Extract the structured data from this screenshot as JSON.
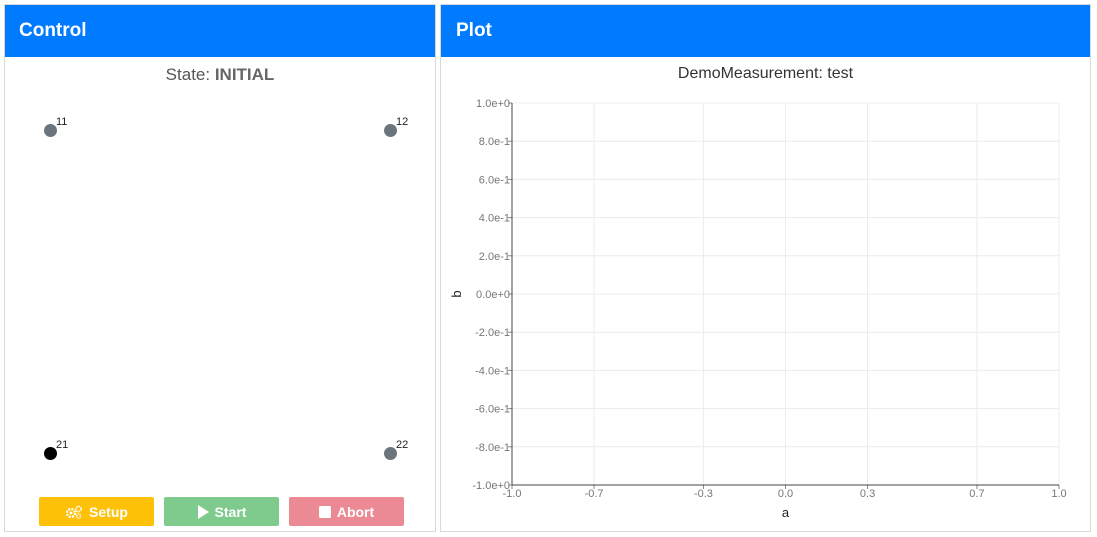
{
  "control": {
    "title": "Control",
    "state_prefix": "State: ",
    "state_value": "INITIAL",
    "nodes": [
      {
        "label": "11",
        "active": false
      },
      {
        "label": "12",
        "active": false
      },
      {
        "label": "21",
        "active": true
      },
      {
        "label": "22",
        "active": false
      }
    ],
    "buttons": {
      "setup": {
        "label": "Setup",
        "icon": "gears-icon",
        "color": "#ffc107"
      },
      "start": {
        "label": "Start",
        "icon": "play-icon",
        "color": "#7fcb8d"
      },
      "abort": {
        "label": "Abort",
        "icon": "stop-icon",
        "color": "#eb8a94"
      }
    }
  },
  "plot": {
    "title": "Plot",
    "chart_data": {
      "type": "line",
      "title": "DemoMeasurement: test",
      "xlabel": "a",
      "ylabel": "b",
      "xlim": [
        -1.0,
        1.0
      ],
      "ylim": [
        -1.0,
        1.0
      ],
      "xticks": [
        "-1.0",
        "-0.7",
        "-0.3",
        "0.0",
        "0.3",
        "0.7",
        "1.0"
      ],
      "yticks": [
        "1.0e+0",
        "8.0e-1",
        "6.0e-1",
        "4.0e-1",
        "2.0e-1",
        "0.0e+0",
        "-2.0e-1",
        "-4.0e-1",
        "-6.0e-1",
        "-8.0e-1",
        "-1.0e+0"
      ],
      "grid": true,
      "series": []
    }
  },
  "colors": {
    "header": "#007bff",
    "node_idle": "#6c757d",
    "node_active": "#000000"
  }
}
